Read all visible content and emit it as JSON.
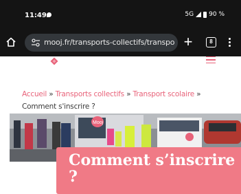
{
  "status_bar": {
    "time": "11:49",
    "network": "5G",
    "battery": "90 %"
  },
  "browser": {
    "url": "mooj.fr/transports-collectifs/transport-sco",
    "tab_count": "8",
    "new_tab_label": "+"
  },
  "breadcrumb": {
    "items": [
      "Accueil",
      "Transports collectifs",
      "Transport scolaire"
    ],
    "separator": "»",
    "current": "Comment s'inscrire ?"
  },
  "hero": {
    "title": "Comment s’inscrire ?",
    "bus_sign": "Mooj"
  },
  "colors": {
    "brand_pink": "#e8637a",
    "title_box": "#f07a86",
    "chrome_dark": "#141414"
  }
}
